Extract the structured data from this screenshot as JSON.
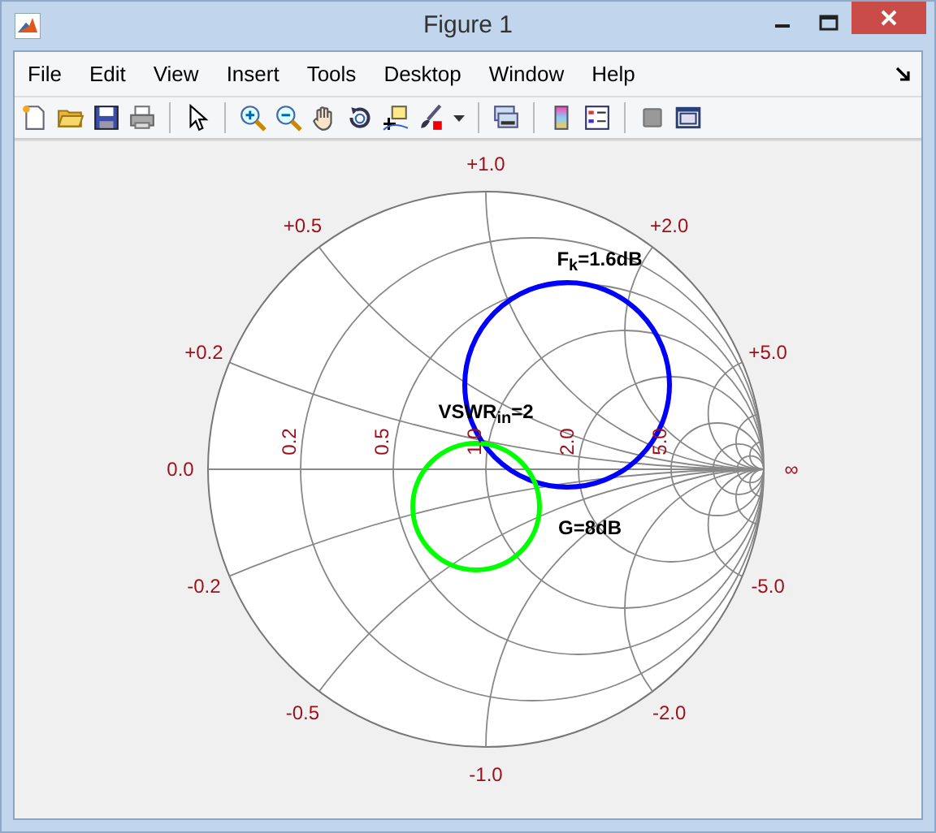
{
  "window": {
    "title": "Figure 1"
  },
  "menu": [
    "File",
    "Edit",
    "View",
    "Insert",
    "Tools",
    "Desktop",
    "Window",
    "Help"
  ],
  "smith_chart": {
    "reactance_labels": [
      "+1.0",
      "+0.5",
      "+2.0",
      "+0.2",
      "+5.0",
      "0.0",
      "∞",
      "-0.2",
      "-5.0",
      "-0.5",
      "-2.0",
      "-1.0"
    ],
    "resistance_labels": [
      "0.2",
      "0.5",
      "1.0",
      "2.0",
      "5.0"
    ],
    "circles": [
      {
        "label": "F$_{k}$=1.6dB",
        "color": "#0000ff"
      },
      {
        "label": "G=8dB",
        "color": "#00ff00"
      }
    ],
    "annotation": "VSWR$_{in}$=2"
  }
}
